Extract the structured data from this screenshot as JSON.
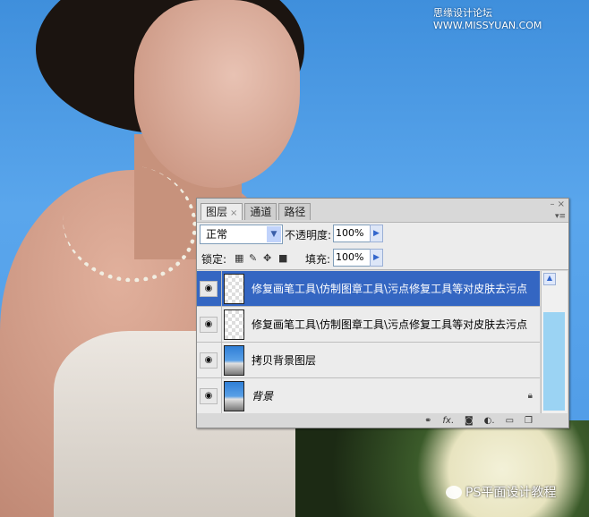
{
  "watermarks": {
    "top": "思缘设计论坛 WWW.MISSYUAN.COM",
    "bottom": "PS平面设计教程"
  },
  "panel": {
    "tabs": [
      {
        "label": "图层",
        "active": true
      },
      {
        "label": "通道"
      },
      {
        "label": "路径"
      }
    ],
    "tab_close": "×",
    "window_controls": "– ×",
    "menu": "▾≡",
    "blend_mode": "正常",
    "opacity_label": "不透明度:",
    "opacity": "100%",
    "lock_label": "锁定:",
    "fill_label": "填充:",
    "fill": "100%",
    "layers": [
      {
        "name": "修复画笔工具\\仿制图章工具\\污点修复工具等对皮肤去污点",
        "selected": true,
        "thumb": "transparent",
        "visible": true
      },
      {
        "name": "修复画笔工具\\仿制图章工具\\污点修复工具等对皮肤去污点",
        "selected": false,
        "thumb": "transparent",
        "visible": true
      },
      {
        "name": "拷贝背景图层",
        "selected": false,
        "thumb": "image",
        "visible": true
      },
      {
        "name": "背景",
        "selected": false,
        "thumb": "image",
        "visible": true,
        "locked": true
      }
    ],
    "bottom_icons": [
      "link-icon",
      "fx-icon",
      "mask-icon",
      "adjustment-icon",
      "folder-icon",
      "new-layer-icon"
    ]
  }
}
